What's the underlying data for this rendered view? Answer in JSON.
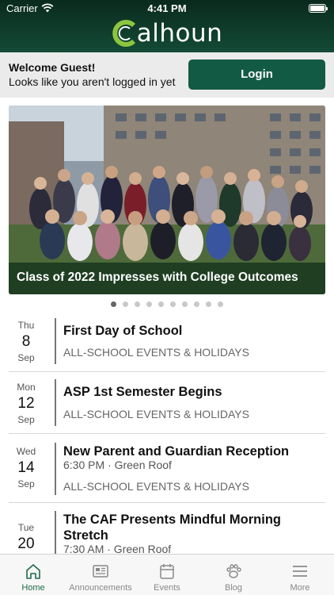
{
  "status_bar": {
    "carrier": "Carrier",
    "time": "4:41 PM"
  },
  "header": {
    "logo_text": "alhoun",
    "logo_mark": "C"
  },
  "welcome": {
    "title": "Welcome Guest!",
    "subtitle": "Looks like you aren't logged in yet",
    "login_label": "Login"
  },
  "hero": {
    "caption": "Class of 2022 Impresses with College Outcomes",
    "slide_count": 10,
    "active_slide": 0
  },
  "events": [
    {
      "dow": "Thu",
      "day": "8",
      "month": "Sep",
      "title": "First Day of School",
      "detail": "",
      "category": "ALL-SCHOOL EVENTS & HOLIDAYS"
    },
    {
      "dow": "Mon",
      "day": "12",
      "month": "Sep",
      "title": "ASP 1st Semester Begins",
      "detail": "",
      "category": "ALL-SCHOOL EVENTS & HOLIDAYS"
    },
    {
      "dow": "Wed",
      "day": "14",
      "month": "Sep",
      "title": "New Parent and Guardian Reception",
      "detail": "6:30 PM · Green Roof",
      "category": "ALL-SCHOOL EVENTS & HOLIDAYS"
    },
    {
      "dow": "Tue",
      "day": "20",
      "month": "Sep",
      "title": "The CAF Presents Mindful Morning Stretch",
      "detail": "7:30 AM · Green Roof",
      "category": ""
    }
  ],
  "tabs": [
    {
      "label": "Home",
      "icon": "home-icon",
      "active": true
    },
    {
      "label": "Announcements",
      "icon": "newspaper-icon",
      "active": false
    },
    {
      "label": "Events",
      "icon": "calendar-icon",
      "active": false
    },
    {
      "label": "Blog",
      "icon": "paw-icon",
      "active": false
    },
    {
      "label": "More",
      "icon": "menu-icon",
      "active": false
    }
  ],
  "colors": {
    "header_dark": "#0a2a1e",
    "brand_green": "#135a45",
    "active_tab": "#1e6b4a",
    "logo_accent": "#8cc63f"
  }
}
